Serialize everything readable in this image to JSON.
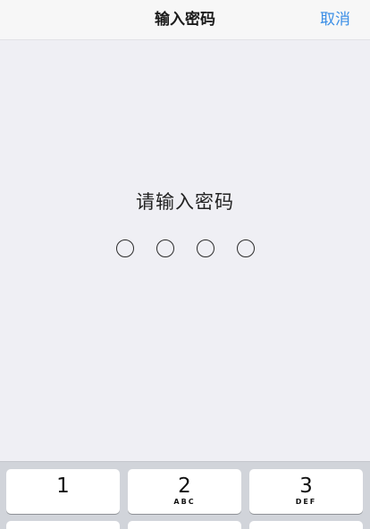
{
  "navbar": {
    "title": "输入密码",
    "cancel_label": "取消"
  },
  "prompt": {
    "text": "请输入密码"
  },
  "passcode": {
    "length": 4,
    "filled": 0
  },
  "keypad": {
    "keys": [
      {
        "digit": "1",
        "letters": ""
      },
      {
        "digit": "2",
        "letters": "ABC"
      },
      {
        "digit": "3",
        "letters": "DEF"
      }
    ]
  },
  "colors": {
    "accent": "#3a8ee6",
    "background": "#efeff4",
    "keyboard": "#d1d4da"
  }
}
